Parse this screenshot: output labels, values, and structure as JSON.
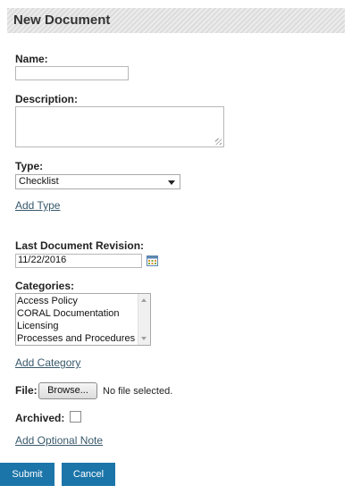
{
  "header": {
    "title": "New Document"
  },
  "form": {
    "name_label": "Name:",
    "name_value": "",
    "description_label": "Description:",
    "description_value": "",
    "type_label": "Type:",
    "type_selected": "Checklist",
    "add_type_link": "Add Type",
    "revision_label": "Last Document Revision:",
    "revision_value": "11/22/2016",
    "categories_label": "Categories:",
    "categories": [
      "Access Policy",
      "CORAL Documentation",
      "Licensing",
      "Processes and Procedures"
    ],
    "add_category_link": "Add Category",
    "file_label": "File:",
    "browse_label": "Browse...",
    "file_status": "No file selected.",
    "archived_label": "Archived:",
    "archived_checked": false,
    "add_note_link": "Add Optional Note"
  },
  "actions": {
    "submit_label": "Submit",
    "cancel_label": "Cancel"
  },
  "colors": {
    "button_bg": "#1b75a9",
    "link": "#39596c"
  }
}
